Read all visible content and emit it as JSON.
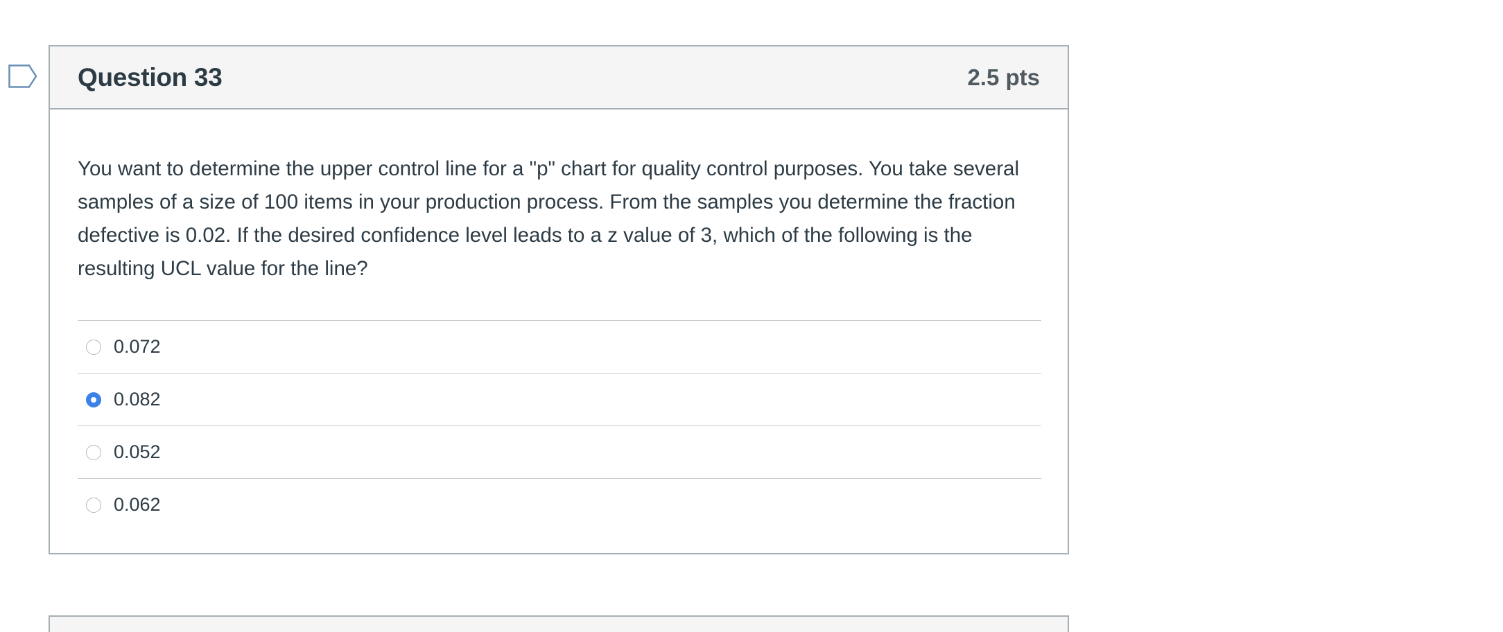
{
  "question": {
    "title": "Question 33",
    "points": "2.5 pts",
    "text": "You want to determine the upper control line for a \"p\" chart for quality control purposes. You take several samples of a size of 100 items in your production process. From the samples you determine the fraction defective is 0.02. If the desired confidence level leads to a z value of 3, which of the following is the resulting UCL value for the line?",
    "answers": [
      {
        "label": "0.072",
        "selected": false
      },
      {
        "label": "0.082",
        "selected": true
      },
      {
        "label": "0.052",
        "selected": false
      },
      {
        "label": "0.062",
        "selected": false
      }
    ]
  },
  "colors": {
    "accent": "#3b82e8",
    "flag": "#6a8fb3",
    "border": "#a5afb5",
    "header_bg": "#f5f5f5"
  },
  "icons": {
    "flag": "bookmark-flag-icon"
  }
}
